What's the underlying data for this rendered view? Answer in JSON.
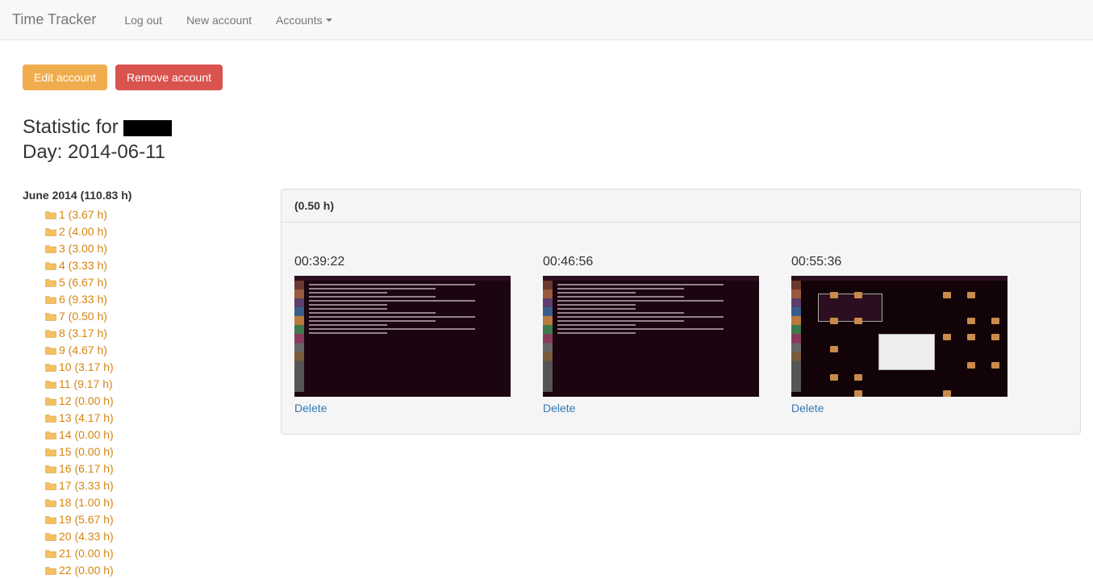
{
  "navbar": {
    "brand": "Time Tracker",
    "logout": "Log out",
    "new_account": "New account",
    "accounts": "Accounts"
  },
  "buttons": {
    "edit": "Edit account",
    "remove": "Remove account"
  },
  "heading": {
    "prefix": "Statistic for",
    "day_label": "Day:",
    "day_value": "2014-06-11"
  },
  "month": {
    "label": "June 2014 (110.83 h)"
  },
  "days": [
    {
      "label": "1 (3.67 h)"
    },
    {
      "label": "2 (4.00 h)"
    },
    {
      "label": "3 (3.00 h)"
    },
    {
      "label": "4 (3.33 h)"
    },
    {
      "label": "5 (6.67 h)"
    },
    {
      "label": "6 (9.33 h)"
    },
    {
      "label": "7 (0.50 h)"
    },
    {
      "label": "8 (3.17 h)"
    },
    {
      "label": "9 (4.67 h)"
    },
    {
      "label": "10 (3.17 h)"
    },
    {
      "label": "11 (9.17 h)"
    },
    {
      "label": "12 (0.00 h)"
    },
    {
      "label": "13 (4.17 h)"
    },
    {
      "label": "14 (0.00 h)"
    },
    {
      "label": "15 (0.00 h)"
    },
    {
      "label": "16 (6.17 h)"
    },
    {
      "label": "17 (3.33 h)"
    },
    {
      "label": "18 (1.00 h)"
    },
    {
      "label": "19 (5.67 h)"
    },
    {
      "label": "20 (4.33 h)"
    },
    {
      "label": "21 (0.00 h)"
    },
    {
      "label": "22 (0.00 h)"
    }
  ],
  "panel": {
    "header": "(0.50 h)"
  },
  "screenshots": [
    {
      "time": "00:39:22",
      "delete": "Delete",
      "type": "terminal"
    },
    {
      "time": "00:46:56",
      "delete": "Delete",
      "type": "terminal"
    },
    {
      "time": "00:55:36",
      "delete": "Delete",
      "type": "desktop"
    }
  ]
}
